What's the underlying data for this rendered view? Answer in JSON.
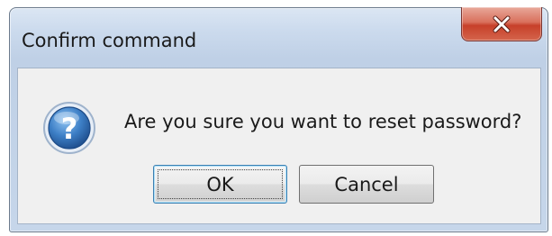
{
  "dialog": {
    "title": "Confirm command",
    "message": "Are you sure you want to reset password?",
    "icon": "question-icon",
    "ok_label": "OK",
    "cancel_label": "Cancel",
    "close_icon": "close-icon"
  },
  "colors": {
    "titlebar": "#cbdaed",
    "client": "#f0f0f0",
    "close_button": "#c7402a",
    "question_icon": "#2f6fb5"
  }
}
